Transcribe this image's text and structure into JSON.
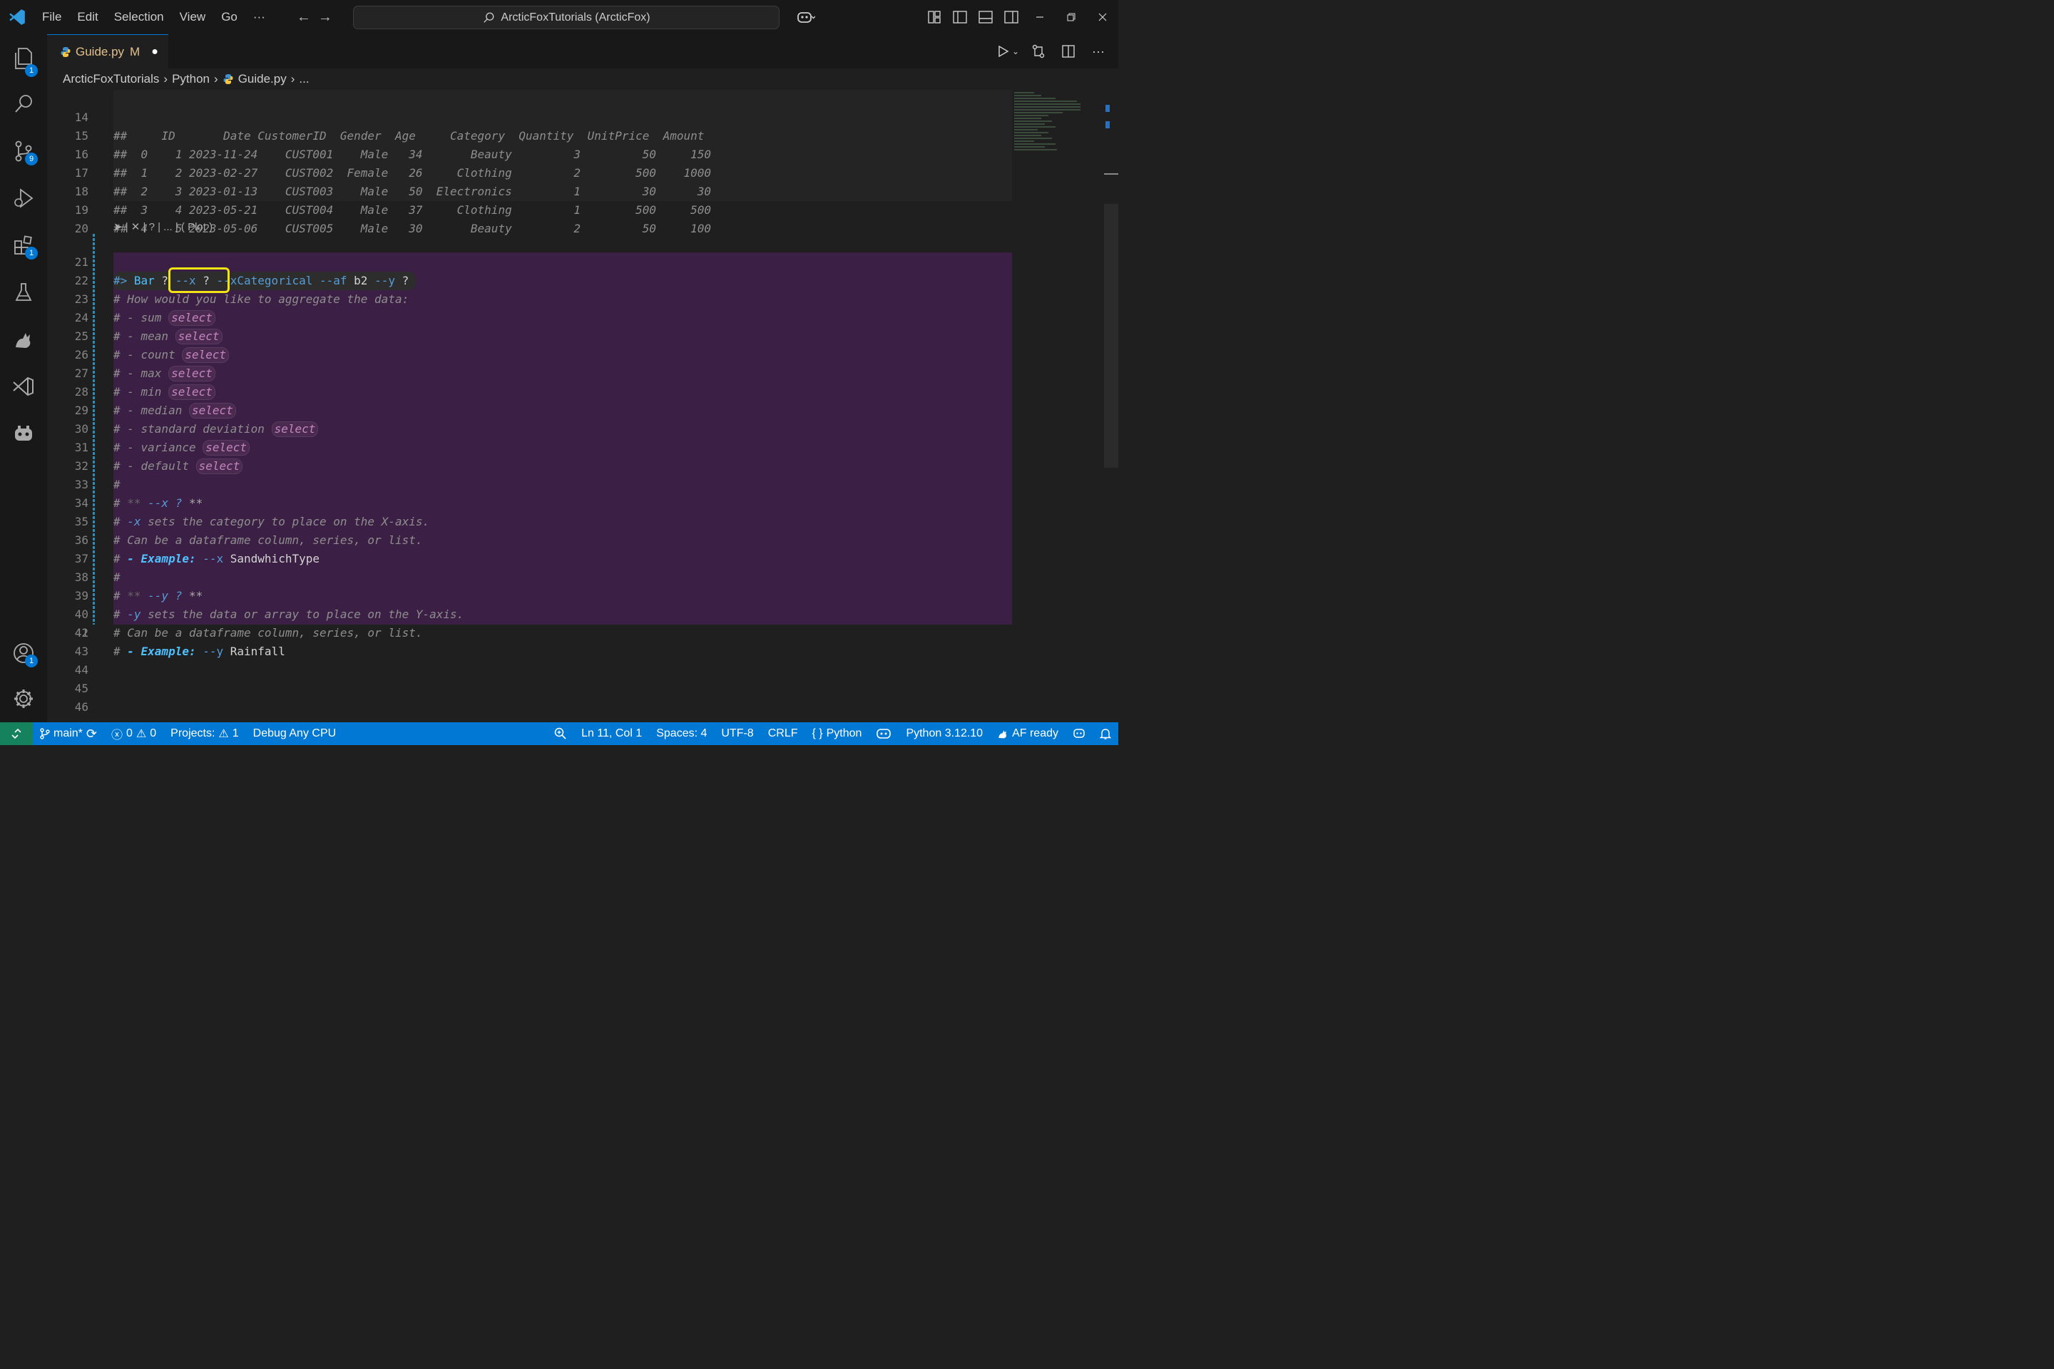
{
  "titlebar": {
    "menu": [
      "File",
      "Edit",
      "Selection",
      "View",
      "Go",
      "···"
    ],
    "search_text": "ArcticFoxTutorials (ArcticFox)"
  },
  "activity_badges": {
    "explorer": "1",
    "scm": "9",
    "extensions": "1",
    "accounts": "1"
  },
  "tab": {
    "name": "Guide.py",
    "status": "M"
  },
  "breadcrumb": [
    "ArcticFoxTutorials",
    "Python",
    "Guide.py",
    "..."
  ],
  "codelens": "➤ | ✕ | ? | ... | ( Plot )",
  "table_header": {
    "ln": "14",
    "text": "##     ID       Date CustomerID  Gender  Age     Category  Quantity  UnitPrice  Amount"
  },
  "table_rows": [
    {
      "ln": "15",
      "text": "##  0    1 2023-11-24    CUST001    Male   34       Beauty         3         50     150"
    },
    {
      "ln": "16",
      "text": "##  1    2 2023-02-27    CUST002  Female   26     Clothing         2        500    1000"
    },
    {
      "ln": "17",
      "text": "##  2    3 2023-01-13    CUST003    Male   50  Electronics         1         30      30"
    },
    {
      "ln": "18",
      "text": "##  3    4 2023-05-21    CUST004    Male   37     Clothing         1        500     500"
    },
    {
      "ln": "19",
      "text": "##  4    5 2023-05-06    CUST005    Male   30       Beauty         2         50     100"
    }
  ],
  "line_numbers": [
    "20",
    "21",
    "22",
    "23",
    "24",
    "25",
    "26",
    "27",
    "28",
    "29",
    "30",
    "31",
    "32",
    "33",
    "34",
    "35",
    "36",
    "37",
    "38",
    "39",
    "40",
    "41",
    "42",
    "43",
    "44",
    "45",
    "46"
  ],
  "magic": {
    "prefix": "#>",
    "cmd": " Bar",
    "q1": " ?",
    "x": " --x",
    "q2": " ?",
    "xcat": " --xCategorical",
    "af": " --af",
    "b2": " b2",
    "y": " --y",
    "q3": " ?"
  },
  "agg_question": "# How would you like to aggregate the data:",
  "agg_options": [
    {
      "label": "# - sum",
      "select": "select"
    },
    {
      "label": "# - mean",
      "select": "select"
    },
    {
      "label": "# - count",
      "select": "select"
    },
    {
      "label": "# - max",
      "select": "select"
    },
    {
      "label": "# - min",
      "select": "select"
    },
    {
      "label": "# - median",
      "select": "select"
    },
    {
      "label": "# - standard deviation",
      "select": "select"
    },
    {
      "label": "# - variance",
      "select": "select"
    },
    {
      "label": "# - default",
      "select": "select"
    }
  ],
  "hash": "#",
  "x_help": {
    "heading_pre": "# ",
    "heading_stars": "**",
    "heading_flag": " --x ?",
    "heading_end": " **",
    "desc_flag": "-x",
    "desc": " sets the category to place on the X-axis.",
    "can_be": "# Can be a dataframe column, series, or list.",
    "ex_label": "- Example:",
    "ex_flag": " --x",
    "ex_value": " SandwhichType"
  },
  "y_help": {
    "heading_pre": "# ",
    "heading_stars": "**",
    "heading_flag": " --y ?",
    "heading_end": " **",
    "desc_flag": "-y",
    "desc": " sets the data or array to place on the Y-axis.",
    "can_be": "# Can be a dataframe column, series, or list.",
    "ex_label": "- Example:",
    "ex_flag": " --y",
    "ex_value": " Rainfall"
  },
  "statusbar": {
    "branch": "main*",
    "errors": "0",
    "warnings": "0",
    "projects": "Projects:",
    "projects_count": "1",
    "debug": "Debug Any CPU",
    "position": "Ln 11, Col 1",
    "spaces": "Spaces: 4",
    "encoding": "UTF-8",
    "eol": "CRLF",
    "language": "Python",
    "interpreter": "Python 3.12.10",
    "af": "AF ready"
  },
  "colors": {
    "accent": "#0078d4",
    "highlight": "#f2e313",
    "purple_bg": "#3c1f45"
  }
}
